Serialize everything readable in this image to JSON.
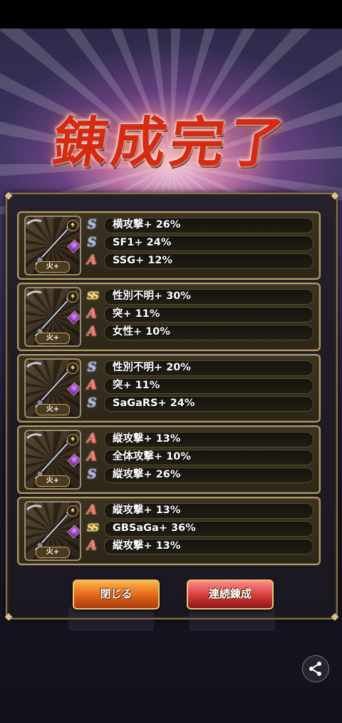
{
  "title": "錬成完了",
  "cards": [
    {
      "element": "火+",
      "rows": [
        {
          "rank": "S",
          "text": "横攻撃+ 26%"
        },
        {
          "rank": "S",
          "text": "SF1+ 24%"
        },
        {
          "rank": "A",
          "text": "SSG+ 12%"
        }
      ]
    },
    {
      "element": "火+",
      "rows": [
        {
          "rank": "SS",
          "text": "性別不明+ 30%"
        },
        {
          "rank": "A",
          "text": "突+ 11%"
        },
        {
          "rank": "A",
          "text": "女性+ 10%"
        }
      ]
    },
    {
      "element": "火+",
      "rows": [
        {
          "rank": "S",
          "text": "性別不明+ 20%"
        },
        {
          "rank": "A",
          "text": "突+ 11%"
        },
        {
          "rank": "S",
          "text": "SaGaRS+ 24%"
        }
      ]
    },
    {
      "element": "火+",
      "rows": [
        {
          "rank": "A",
          "text": "縦攻撃+ 13%"
        },
        {
          "rank": "A",
          "text": "全体攻撃+ 10%"
        },
        {
          "rank": "S",
          "text": "縦攻撃+ 26%"
        }
      ]
    },
    {
      "element": "火+",
      "rows": [
        {
          "rank": "A",
          "text": "縦攻撃+ 13%"
        },
        {
          "rank": "SS",
          "text": "GBSaGa+ 36%"
        },
        {
          "rank": "A",
          "text": "縦攻撃+ 13%"
        }
      ]
    }
  ],
  "buttons": {
    "close_label": "閉じる",
    "continue_label": "連続錬成"
  },
  "icons": {
    "share": "share-icon",
    "weapon": "spear-icon",
    "gem": "gem-icon",
    "lock": "lock-icon"
  },
  "colors": {
    "rank_A": "#ff7a6a",
    "rank_S": "#aab8e8",
    "rank_SS": "#ffd45a",
    "close_button": "#e0641a",
    "continue_button": "#d43a3a"
  }
}
